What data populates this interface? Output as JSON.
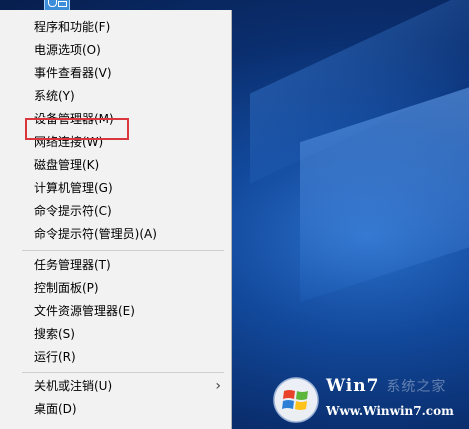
{
  "menu": {
    "groups": [
      {
        "items": [
          {
            "label": "程序和功能(F)"
          },
          {
            "label": "电源选项(O)"
          },
          {
            "label": "事件查看器(V)"
          },
          {
            "label": "系统(Y)"
          },
          {
            "label": "设备管理器(M)",
            "highlighted": true
          },
          {
            "label": "网络连接(W)"
          },
          {
            "label": "磁盘管理(K)"
          },
          {
            "label": "计算机管理(G)"
          },
          {
            "label": "命令提示符(C)"
          },
          {
            "label": "命令提示符(管理员)(A)"
          }
        ]
      },
      {
        "items": [
          {
            "label": "任务管理器(T)"
          },
          {
            "label": "控制面板(P)"
          },
          {
            "label": "文件资源管理器(E)"
          },
          {
            "label": "搜索(S)"
          },
          {
            "label": "运行(R)"
          }
        ]
      },
      {
        "items": [
          {
            "label": "关机或注销(U)",
            "has_submenu": true,
            "submenu_icon": "chevron-right-icon",
            "arrow": "›"
          },
          {
            "label": "桌面(D)"
          }
        ]
      }
    ]
  },
  "highlight": {
    "color": "#d9363e",
    "target": "设备管理器(M)"
  },
  "watermark": {
    "brand": "Win7",
    "brand_accent": "7",
    "brand_suffix": "系统之家",
    "url": "Www.Winwin7.com",
    "logo_icon": "windows-logo-icon"
  },
  "start_button": {
    "icon": "start-icon"
  },
  "colors": {
    "menu_bg": "#f2f2f2",
    "desktop_bg": "#0a2e6e",
    "highlight": "#d9363e"
  }
}
